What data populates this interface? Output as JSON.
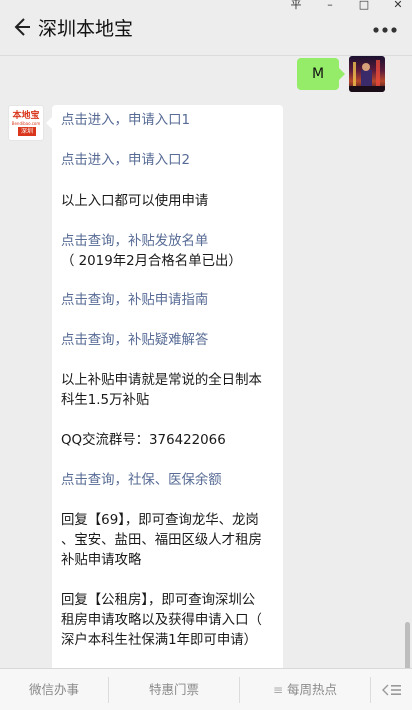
{
  "window": {
    "controls": [
      "平",
      "–",
      "□",
      "✕"
    ]
  },
  "header": {
    "title": "深圳本地宝",
    "back_icon": "back-arrow-icon",
    "more_icon": "more-dots-icon"
  },
  "chat": {
    "my_message": "M",
    "bot_avatar": {
      "logo_text": "本地宝",
      "logo_small": "Bendibao.com",
      "logo_badge": "深圳"
    },
    "bot_message": {
      "link_entry1": "点击进入，申请入口1",
      "link_entry2": "点击进入，申请入口2",
      "text_both": "以上入口都可以使用申请",
      "link_list": "点击查询，补贴发放名单",
      "text_list_note": "（ 2019年2月合格名单已出）",
      "link_guide": "点击查询，补贴申请指南",
      "link_faq": "点击查询，补贴疑难解答",
      "text_subsidy_line1": "以上补贴申请就是常说的全日制本",
      "text_subsidy_line2": "科生1.5万补贴",
      "text_qq": "QQ交流群号：376422066",
      "link_social": "点击查询，社保、医保余额",
      "text_69_line1": "回复【69】，即可查询龙华、龙岗",
      "text_69_line2": "、宝安、盐田、福田区级人才租房",
      "text_69_line3": "补贴申请攻略",
      "text_rent_line1": "回复【公租房】，即可查询深圳公",
      "text_rent_line2": "租房申请攻略以及获得申请入口（",
      "text_rent_line3": "深户本科生社保满1年即可申请）"
    }
  },
  "bottom_menu": {
    "items": [
      "微信办事",
      "特惠门票",
      "每周热点"
    ],
    "keyboard_icon": "keyboard-toggle-icon"
  },
  "colors": {
    "link": "#576b95",
    "my_bubble": "#95ec69",
    "background": "#ededed"
  }
}
